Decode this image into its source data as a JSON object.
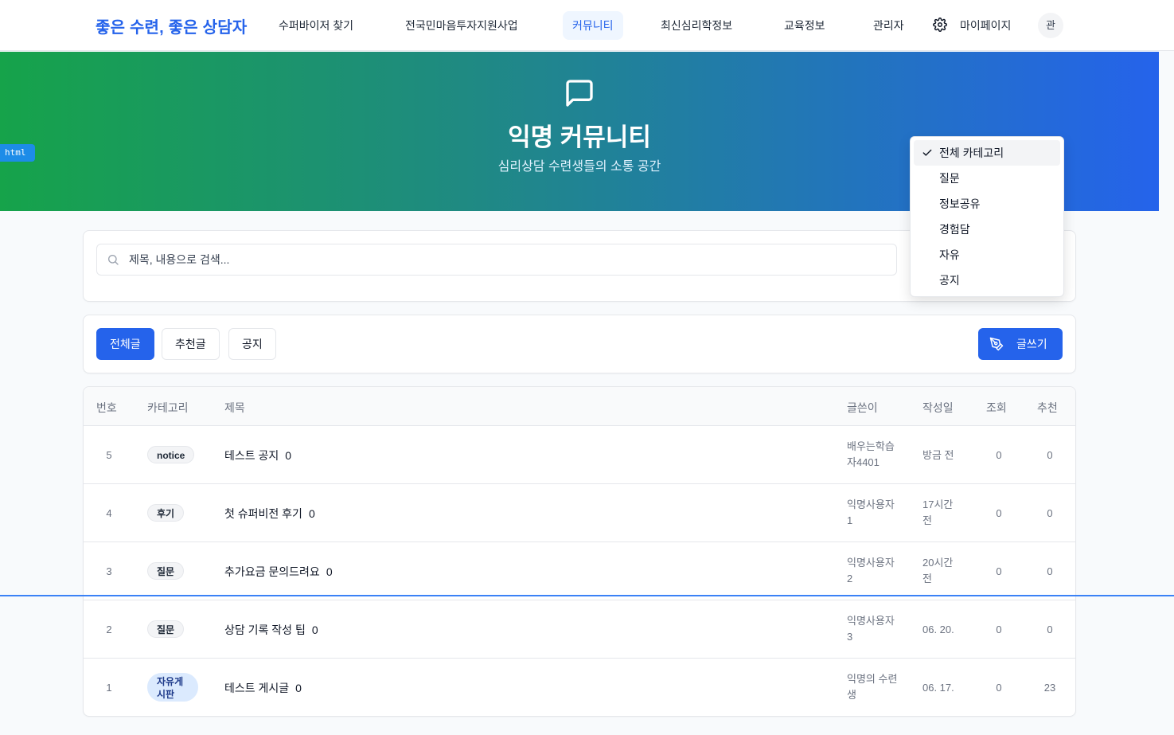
{
  "nav": {
    "brand": "좋은 수련, 좋은 상담자",
    "items": [
      {
        "label": "수퍼바이저 찾기",
        "active": false
      },
      {
        "label": "전국민마음투자지원사업",
        "active": false
      },
      {
        "label": "커뮤니티",
        "active": true
      },
      {
        "label": "최신심리학정보",
        "active": false
      },
      {
        "label": "교육정보",
        "active": false
      },
      {
        "label": "관리자",
        "active": false
      },
      {
        "label": "마이페이지",
        "active": false
      }
    ],
    "avatar": "관"
  },
  "badge_tag": "html",
  "hero": {
    "icon": "message-square-icon",
    "title": "익명 커뮤니티",
    "subtitle": "심리상담 수련생들의 소통 공간"
  },
  "search": {
    "placeholder": "제목, 내용으로 검색..."
  },
  "filters": {
    "tabs": [
      "전체글",
      "추천글",
      "공지"
    ],
    "active": "전체글",
    "write_label": "글쓰기"
  },
  "category_dropdown": {
    "selected": "전체 카테고리",
    "options": [
      "전체 카테고리",
      "질문",
      "정보공유",
      "경험담",
      "자유",
      "공지"
    ]
  },
  "table": {
    "headers": [
      "번호",
      "카테고리",
      "제목",
      "글쓴이",
      "작성일",
      "조회",
      "추천"
    ],
    "rows": [
      {
        "num": "5",
        "category": "notice",
        "title": "테스트 공지",
        "comments": "0",
        "author": "배우는학습자4401",
        "date": "방금 전",
        "views": "0",
        "recs": "0"
      },
      {
        "num": "4",
        "category": "후기",
        "title": "첫 슈퍼비전 후기",
        "comments": "0",
        "author": "익명사용자1",
        "date": "17시간 전",
        "views": "0",
        "recs": "0"
      },
      {
        "num": "3",
        "category": "질문",
        "title": "추가요금 문의드려요",
        "comments": "0",
        "author": "익명사용자2",
        "date": "20시간 전",
        "views": "0",
        "recs": "0"
      },
      {
        "num": "2",
        "category": "질문",
        "title": "상담 기록 작성 팁",
        "comments": "0",
        "author": "익명사용자3",
        "date": "06. 20.",
        "views": "0",
        "recs": "0"
      },
      {
        "num": "1",
        "category": "자유게시판",
        "title": "테스트 게시글",
        "comments": "0",
        "author": "익명의 수련생",
        "date": "06. 17.",
        "views": "0",
        "recs": "23"
      }
    ]
  },
  "colors": {
    "primary": "#2563eb",
    "hero_start": "#16a34a",
    "hero_end": "#2563eb"
  }
}
